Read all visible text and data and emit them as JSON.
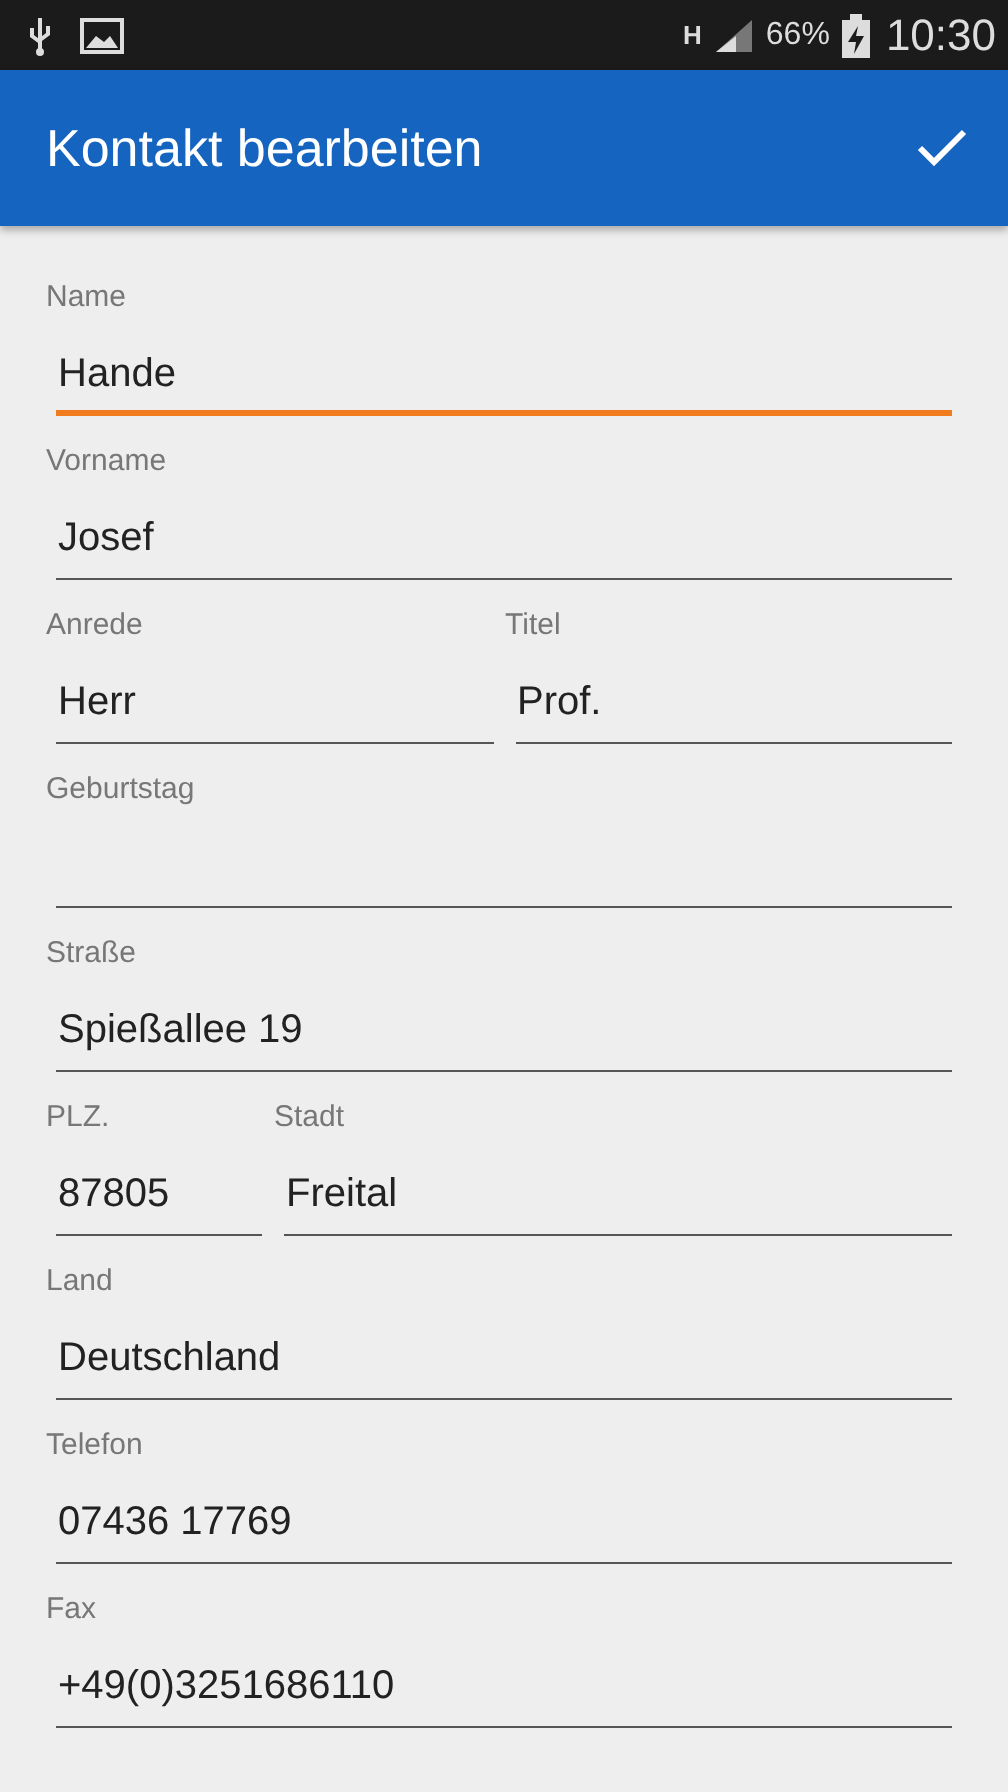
{
  "status_bar": {
    "battery": "66%",
    "time": "10:30",
    "network": "H"
  },
  "app_bar": {
    "title": "Kontakt bearbeiten"
  },
  "rows": [
    {
      "kind": "single",
      "fields": [
        {
          "label": "Name",
          "value": "Hande",
          "focused": true
        }
      ]
    },
    {
      "kind": "single",
      "fields": [
        {
          "label": "Vorname",
          "value": "Josef",
          "focused": false
        }
      ]
    },
    {
      "kind": "half",
      "fields": [
        {
          "label": "Anrede",
          "value": "Herr",
          "focused": false
        },
        {
          "label": "Titel",
          "value": "Prof.",
          "focused": false
        }
      ]
    },
    {
      "kind": "single",
      "fields": [
        {
          "label": "Geburtstag",
          "focused": false
        }
      ]
    },
    {
      "kind": "single",
      "fields": [
        {
          "label": "Straße",
          "value": "Spießallee 19",
          "focused": false
        }
      ]
    },
    {
      "kind": "zip",
      "fields": [
        {
          "label": "PLZ.",
          "value": "87805",
          "focused": false
        },
        {
          "label": "Stadt",
          "value": "Freital",
          "focused": false
        }
      ]
    },
    {
      "kind": "single",
      "fields": [
        {
          "label": "Land",
          "value": "Deutschland",
          "focused": false
        }
      ]
    },
    {
      "kind": "single",
      "fields": [
        {
          "label": "Telefon",
          "value": "07436 17769",
          "focused": false
        }
      ]
    },
    {
      "kind": "single",
      "fields": [
        {
          "label": "Fax",
          "value": "+49(0)3251686110",
          "focused": false
        }
      ]
    }
  ]
}
